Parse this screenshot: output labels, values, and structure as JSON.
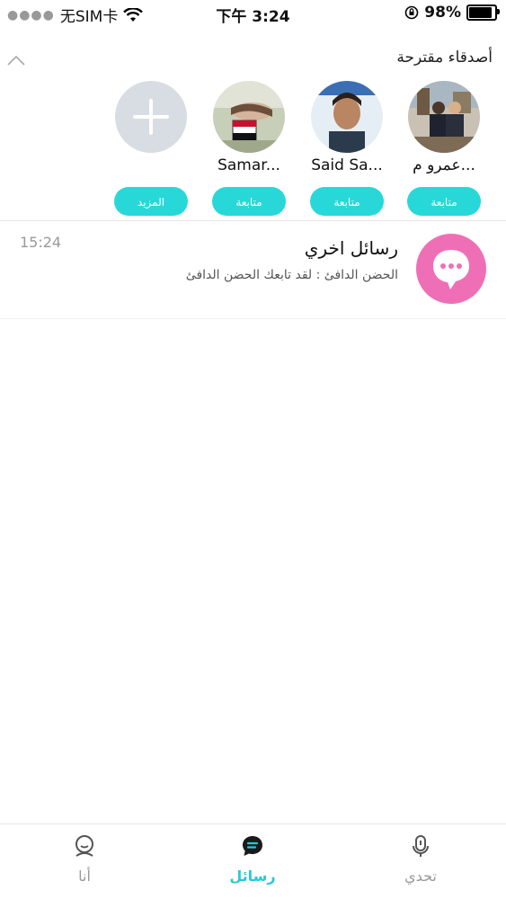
{
  "status_bar": {
    "carrier": "无SIM卡",
    "time": "下午 3:24",
    "battery": "98%",
    "battery_level": 0.98
  },
  "suggested": {
    "title": "أصدقاء مقترحة",
    "friends": [
      {
        "name": "عمرو م...",
        "button": "متابعة"
      },
      {
        "name": "Said Sa...",
        "button": "متابعة"
      },
      {
        "name": "Samar...",
        "button": "متابعة"
      }
    ],
    "more_button": "المزيد"
  },
  "message": {
    "title": "رسائل اخري",
    "preview": "الحضن الدافئ : لقد تابعك الحضن الدافئ",
    "time": "15:24"
  },
  "tabs": [
    {
      "label": "تحدي",
      "icon": "microphone-icon",
      "active": false
    },
    {
      "label": "رسائل",
      "icon": "chat-icon",
      "active": true
    },
    {
      "label": "أنا",
      "icon": "profile-icon",
      "active": false
    }
  ],
  "colors": {
    "accent": "#29c9d6",
    "follow_button": "#28d8d8",
    "message_icon": "#ef6fb6"
  }
}
